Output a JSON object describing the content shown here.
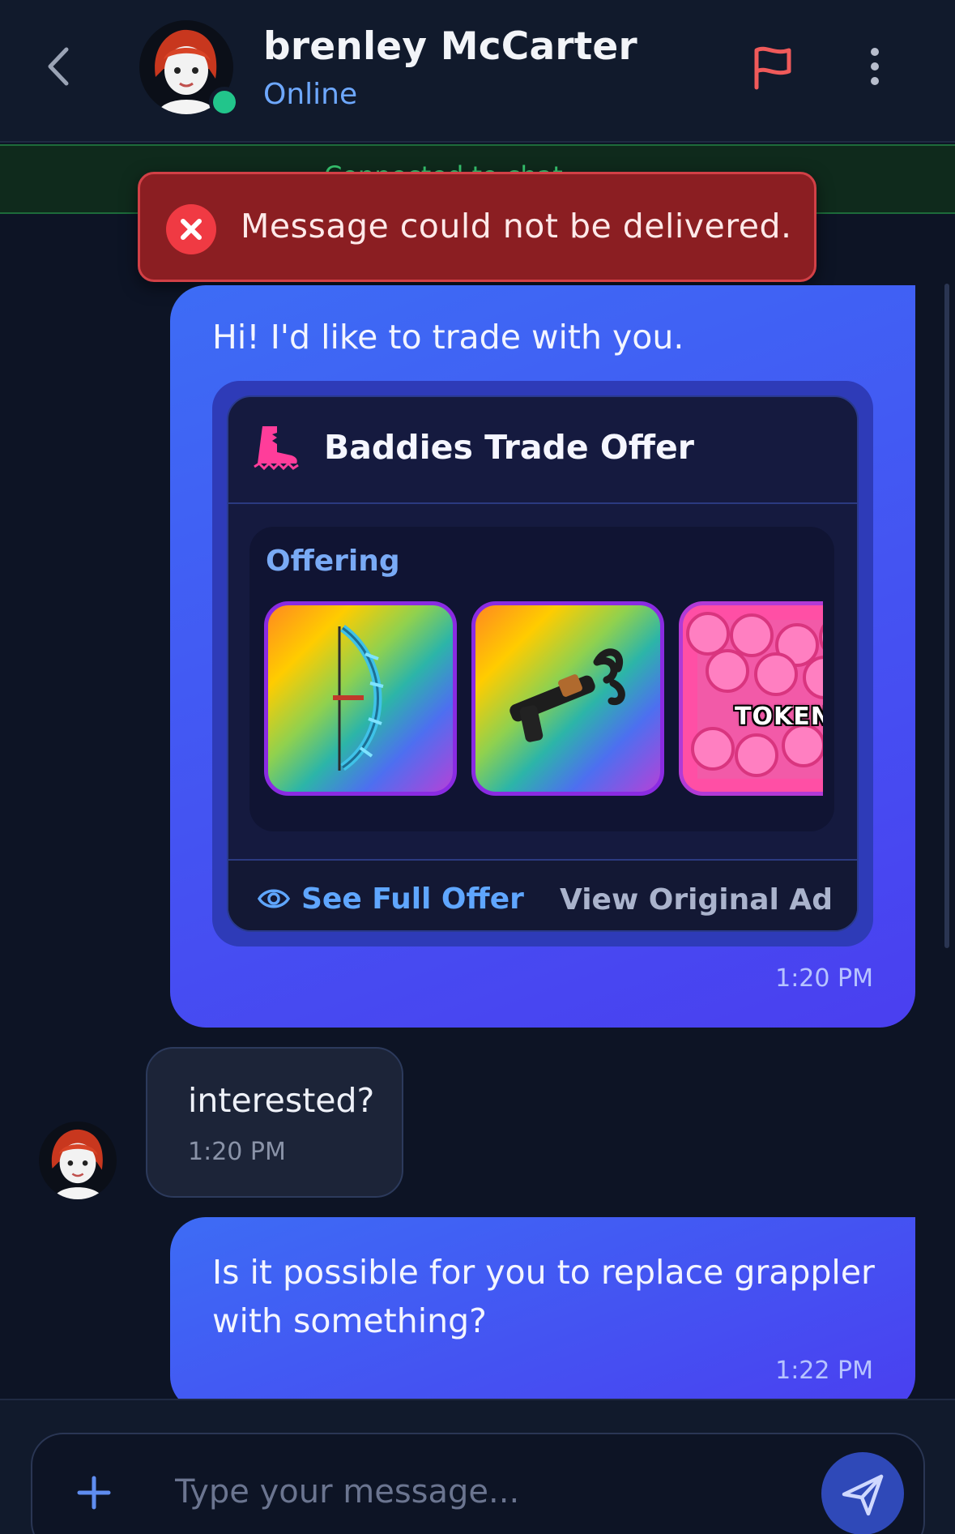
{
  "header": {
    "user_name": "brenley McCarter",
    "status": "Online"
  },
  "connected_banner": {
    "text": "Connected to chat"
  },
  "error_toast": {
    "message": "Message could not be delivered."
  },
  "messages": [
    {
      "direction": "outgoing",
      "text": "Hi! I'd like to trade with you.",
      "time": "1:20 PM",
      "trade_offer": {
        "title": "Baddies Trade Offer",
        "section_label": "Offering",
        "items": [
          {
            "icon": "bow-item-icon"
          },
          {
            "icon": "grappler-item-icon"
          },
          {
            "icon": "tokens-item-icon",
            "label": "TOKENS"
          }
        ],
        "see_full_label": "See Full Offer",
        "view_original_label": "View Original Ad"
      }
    },
    {
      "direction": "incoming",
      "text": "interested?",
      "time": "1:20 PM"
    },
    {
      "direction": "outgoing",
      "text": "Is it possible for you to replace grappler with something?",
      "time": "1:22 PM"
    }
  ],
  "composer": {
    "placeholder": "Type your message..."
  },
  "colors": {
    "accent": "#3d6cf5",
    "online": "#22c58b",
    "error": "#8b1e22",
    "flag": "#f05a5a"
  }
}
